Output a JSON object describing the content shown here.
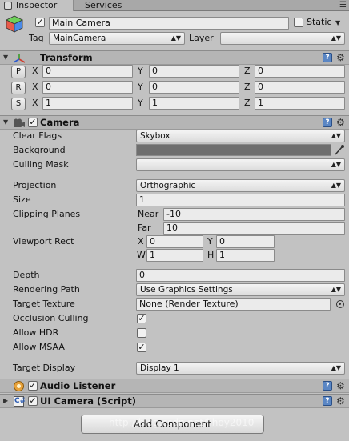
{
  "tabs": [
    {
      "label": "Inspector",
      "active": true
    },
    {
      "label": "Services",
      "active": false
    }
  ],
  "gameobject": {
    "active": true,
    "name": "Main Camera",
    "static_label": "Static",
    "tag_label": "Tag",
    "tag_value": "MainCamera",
    "layer_label": "Layer",
    "layer_value": ""
  },
  "transform": {
    "title": "Transform",
    "rows": [
      {
        "button": "P",
        "x": "0",
        "y": "0",
        "z": "0"
      },
      {
        "button": "R",
        "x": "0",
        "y": "0",
        "z": "0"
      },
      {
        "button": "S",
        "x": "1",
        "y": "1",
        "z": "1"
      }
    ],
    "axis_x": "X",
    "axis_y": "Y",
    "axis_z": "Z"
  },
  "camera": {
    "title": "Camera",
    "enabled": true,
    "clear_flags_label": "Clear Flags",
    "clear_flags_value": "Skybox",
    "background_label": "Background",
    "background_color": "#6e6e6e",
    "culling_mask_label": "Culling Mask",
    "culling_mask_value": "",
    "projection_label": "Projection",
    "projection_value": "Orthographic",
    "size_label": "Size",
    "size_value": "1",
    "clipping_label": "Clipping Planes",
    "near_label": "Near",
    "near_value": "-10",
    "far_label": "Far",
    "far_value": "10",
    "viewport_label": "Viewport Rect",
    "vp_x_label": "X",
    "vp_x": "0",
    "vp_y_label": "Y",
    "vp_y": "0",
    "vp_w_label": "W",
    "vp_w": "1",
    "vp_h_label": "H",
    "vp_h": "1",
    "depth_label": "Depth",
    "depth_value": "0",
    "rendering_path_label": "Rendering Path",
    "rendering_path_value": "Use Graphics Settings",
    "target_texture_label": "Target Texture",
    "target_texture_value": "None (Render Texture)",
    "occlusion_label": "Occlusion Culling",
    "occlusion_checked": true,
    "hdr_label": "Allow HDR",
    "hdr_checked": false,
    "msaa_label": "Allow MSAA",
    "msaa_checked": true,
    "target_display_label": "Target Display",
    "target_display_value": "Display 1"
  },
  "audio_listener": {
    "title": "Audio Listener",
    "enabled": true
  },
  "ui_camera": {
    "title": "UI Camera (Script)",
    "enabled": true
  },
  "add_component_label": "Add Component",
  "watermark_text": "http://blog.csdn.net/lihoy2010",
  "icons": {
    "help": "help-icon",
    "gear": "gear-icon",
    "check": "✓"
  }
}
